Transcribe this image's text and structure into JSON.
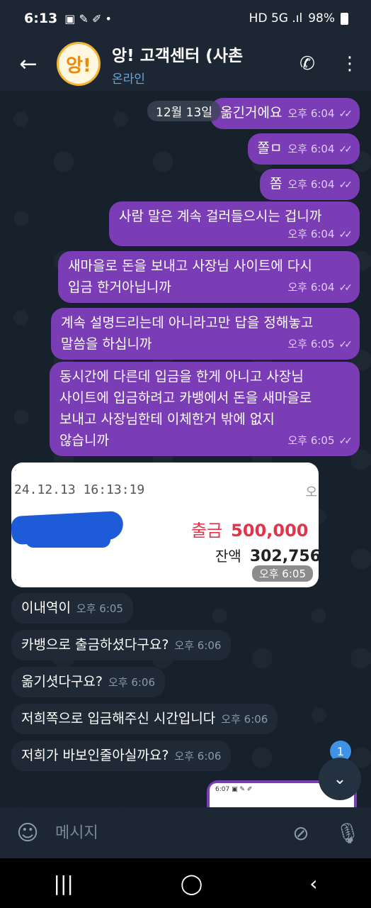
{
  "status_bar": {
    "time": "6:13",
    "battery": "98%",
    "left_icons": "▣ ✎ ✐ •",
    "right_icons": "HD 5G .ıl"
  },
  "header": {
    "title": "앙! 고객센터 (사촌",
    "status": "온라인",
    "avatar_text": "앙!"
  },
  "date_pill": "12월 13일",
  "messages": [
    {
      "dir": "out",
      "text": "옮긴거에요",
      "time": "오후 6:04"
    },
    {
      "dir": "out",
      "text": "쫄ㅁ",
      "time": "오후 6:04"
    },
    {
      "dir": "out",
      "text": "쫌",
      "time": "오후 6:04"
    },
    {
      "dir": "out",
      "text": "사람 말은 계속 걸러들으시는 겁니까",
      "time": "오후 6:04"
    },
    {
      "dir": "out",
      "line1": "새마을로 돈을 보내고 사장님 사이트에 다시",
      "line2": "입금 한거아닙니까",
      "time": "오후 6:04"
    },
    {
      "dir": "out",
      "line1": "계속 설명드리는데 아니라고만 답을 정해놓고",
      "line2": "말씀을 하십니까",
      "time": "오후 6:05"
    },
    {
      "dir": "out",
      "line1": "동시간에 다른데 입금을 한게 아니고 사장님",
      "line2": "사이트에 입금하려고 카뱅에서 돈을 새마을로",
      "line3": "보내고 사장님한테 이체한거 밖에 없지",
      "line4": "않습니까",
      "time": "오후 6:05"
    },
    {
      "dir": "in",
      "text": "이내역이",
      "time": "오후 6:05"
    },
    {
      "dir": "in",
      "text": "카뱅으로 출금하셨다구요?",
      "time": "오후 6:06"
    },
    {
      "dir": "in",
      "text": "옮기셧다구요?",
      "time": "오후 6:06"
    },
    {
      "dir": "in",
      "text": "저희쪽으로 입금해주신 시간입니다",
      "time": "오후 6:06"
    },
    {
      "dir": "in",
      "text": "저희가 바보인줄아실까요?",
      "time": "오후 6:06"
    }
  ],
  "image_message": {
    "date": "24.12.13 16:13:19",
    "corner": "오",
    "withdraw_label": "출금",
    "withdraw_amount": "500,000",
    "balance_label": "잔액",
    "balance_amount": "302,756",
    "time": "오후 6:05"
  },
  "thumb": {
    "text": "6:07 ▣ ✎ ✐"
  },
  "scroll_badge": "1",
  "input": {
    "placeholder": "메시지"
  },
  "colors": {
    "outgoing": "#7b3db5",
    "incoming": "#1f2a36",
    "accent": "#3f93e5"
  }
}
